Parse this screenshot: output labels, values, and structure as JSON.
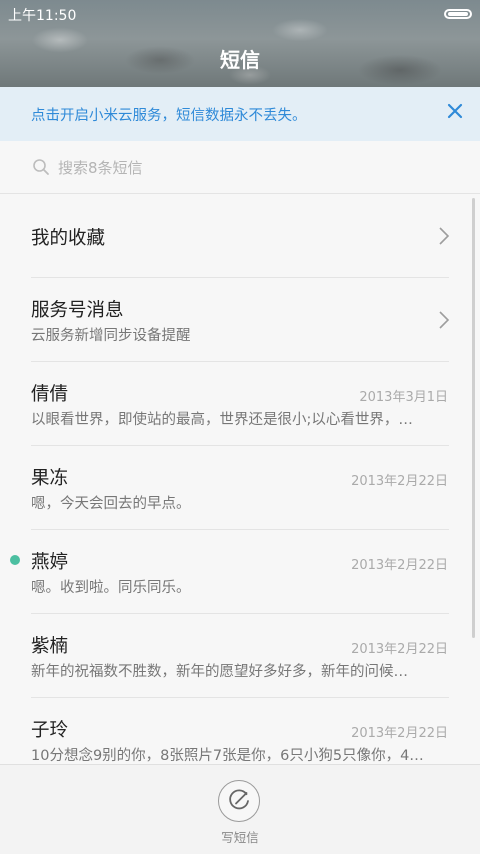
{
  "status_bar": {
    "time": "上午11:50"
  },
  "header": {
    "title": "短信"
  },
  "banner": {
    "text": "点击开启小米云服务，短信数据永不丢失。"
  },
  "search": {
    "placeholder": "搜索8条短信"
  },
  "list": [
    {
      "name": "我的收藏",
      "sub": "",
      "date": "",
      "chevron": true,
      "unread": false
    },
    {
      "name": "服务号消息",
      "sub": "云服务新增同步设备提醒",
      "date": "",
      "chevron": true,
      "unread": false
    },
    {
      "name": "倩倩",
      "sub": "以眼看世界，即使站的最高，世界还是很小;以心看世界，…",
      "date": "2013年3月1日",
      "chevron": false,
      "unread": false
    },
    {
      "name": "果冻",
      "sub": "嗯，今天会回去的早点。",
      "date": "2013年2月22日",
      "chevron": false,
      "unread": false
    },
    {
      "name": "燕婷",
      "sub": "嗯。收到啦。同乐同乐。",
      "date": "2013年2月22日",
      "chevron": false,
      "unread": true
    },
    {
      "name": "紫楠",
      "sub": "新年的祝福数不胜数，新年的愿望好多好多，新年的问候…",
      "date": "2013年2月22日",
      "chevron": false,
      "unread": false
    },
    {
      "name": "子玲",
      "sub": "10分想念9别的你，8张照片7张是你，6只小狗5只像你，4…",
      "date": "2013年2月22日",
      "chevron": false,
      "unread": false
    }
  ],
  "bottom": {
    "compose_label": "写短信"
  },
  "colors": {
    "accent": "#2f8ad8",
    "banner_bg": "#e3eef6",
    "unread_dot": "#4cbfa1"
  }
}
